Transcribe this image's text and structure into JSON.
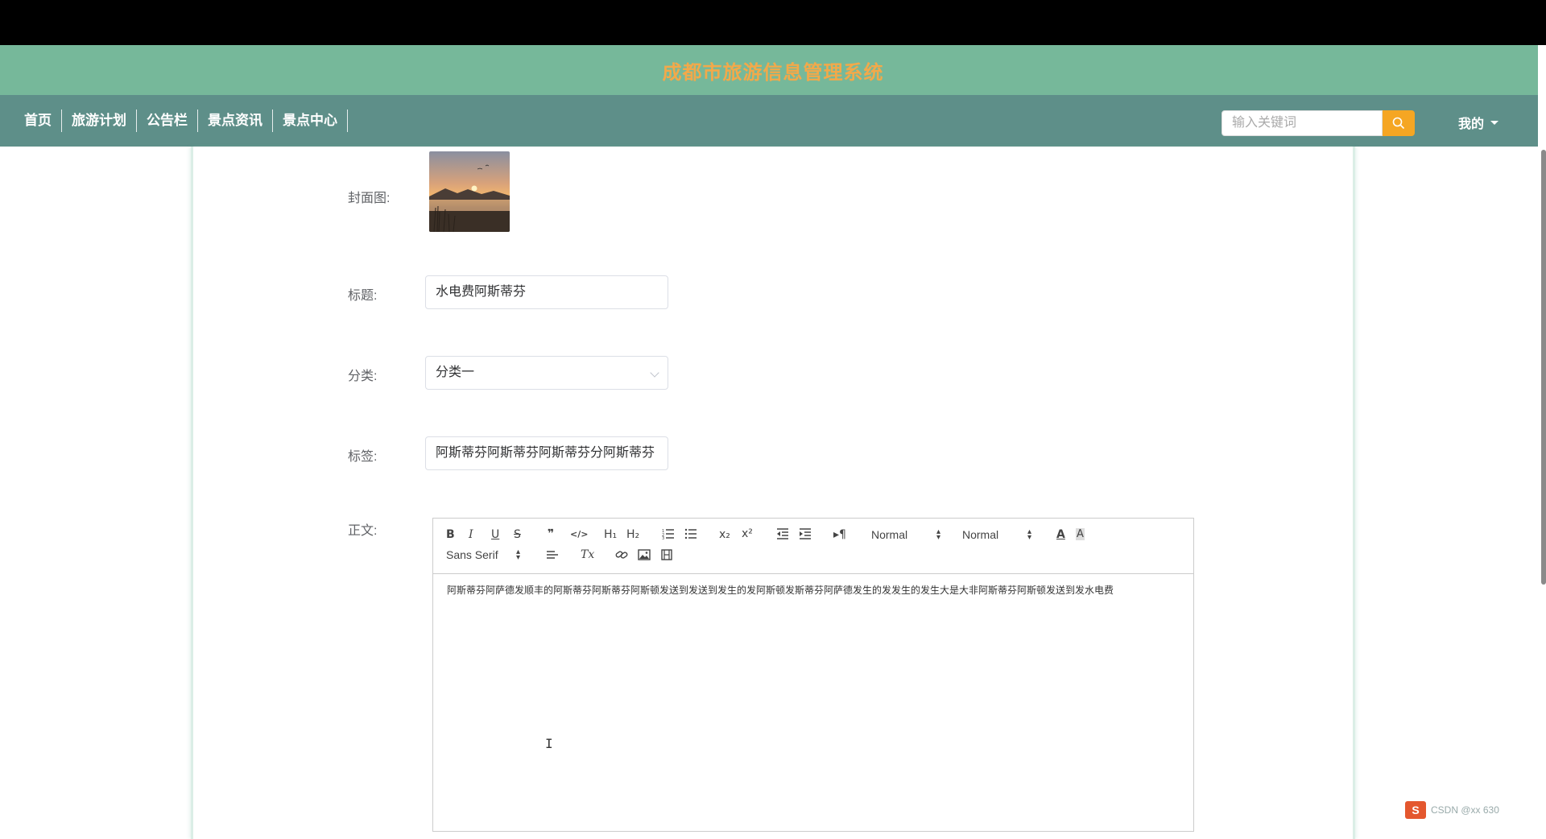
{
  "site": {
    "title": "成都市旅游信息管理系统"
  },
  "nav": {
    "items": [
      "首页",
      "旅游计划",
      "公告栏",
      "景点资讯",
      "景点中心"
    ]
  },
  "search": {
    "placeholder": "输入关键词"
  },
  "user": {
    "menu_label": "我的"
  },
  "form": {
    "cover_label": "封面图:",
    "title_label": "标题:",
    "title_value": "水电费阿斯蒂芬",
    "category_label": "分类:",
    "category_value": "分类一",
    "tags_label": "标签:",
    "tags_value": "阿斯蒂芬阿斯蒂芬阿斯蒂芬分阿斯蒂芬",
    "body_label": "正文:"
  },
  "editor": {
    "toolbar": {
      "bold": "B",
      "italic": "I",
      "underline": "U",
      "strike": "S",
      "quote": "❞",
      "code": "</>",
      "h1": "H₁",
      "h2": "H₂",
      "subscript": "x₂",
      "superscript": "x²",
      "rtl": "¶",
      "header_select": "Normal",
      "size_select": "Normal",
      "font_select": "Sans Serif",
      "clean": "Tx"
    },
    "content": "阿斯蒂芬阿萨德发顺丰的阿斯蒂芬阿斯蒂芬阿斯顿发送到发送到发生的发阿斯顿发斯蒂芬阿萨德发生的发发生的发生大是大非阿斯蒂芬阿斯顿发送到发水电费"
  },
  "watermark": {
    "brand": "S",
    "text": "CSDN @xx 630"
  },
  "colors": {
    "header_bg": "#76b89a",
    "nav_bg": "#5e8f89",
    "title": "#f2a94a",
    "search_btn": "#f5a623"
  }
}
